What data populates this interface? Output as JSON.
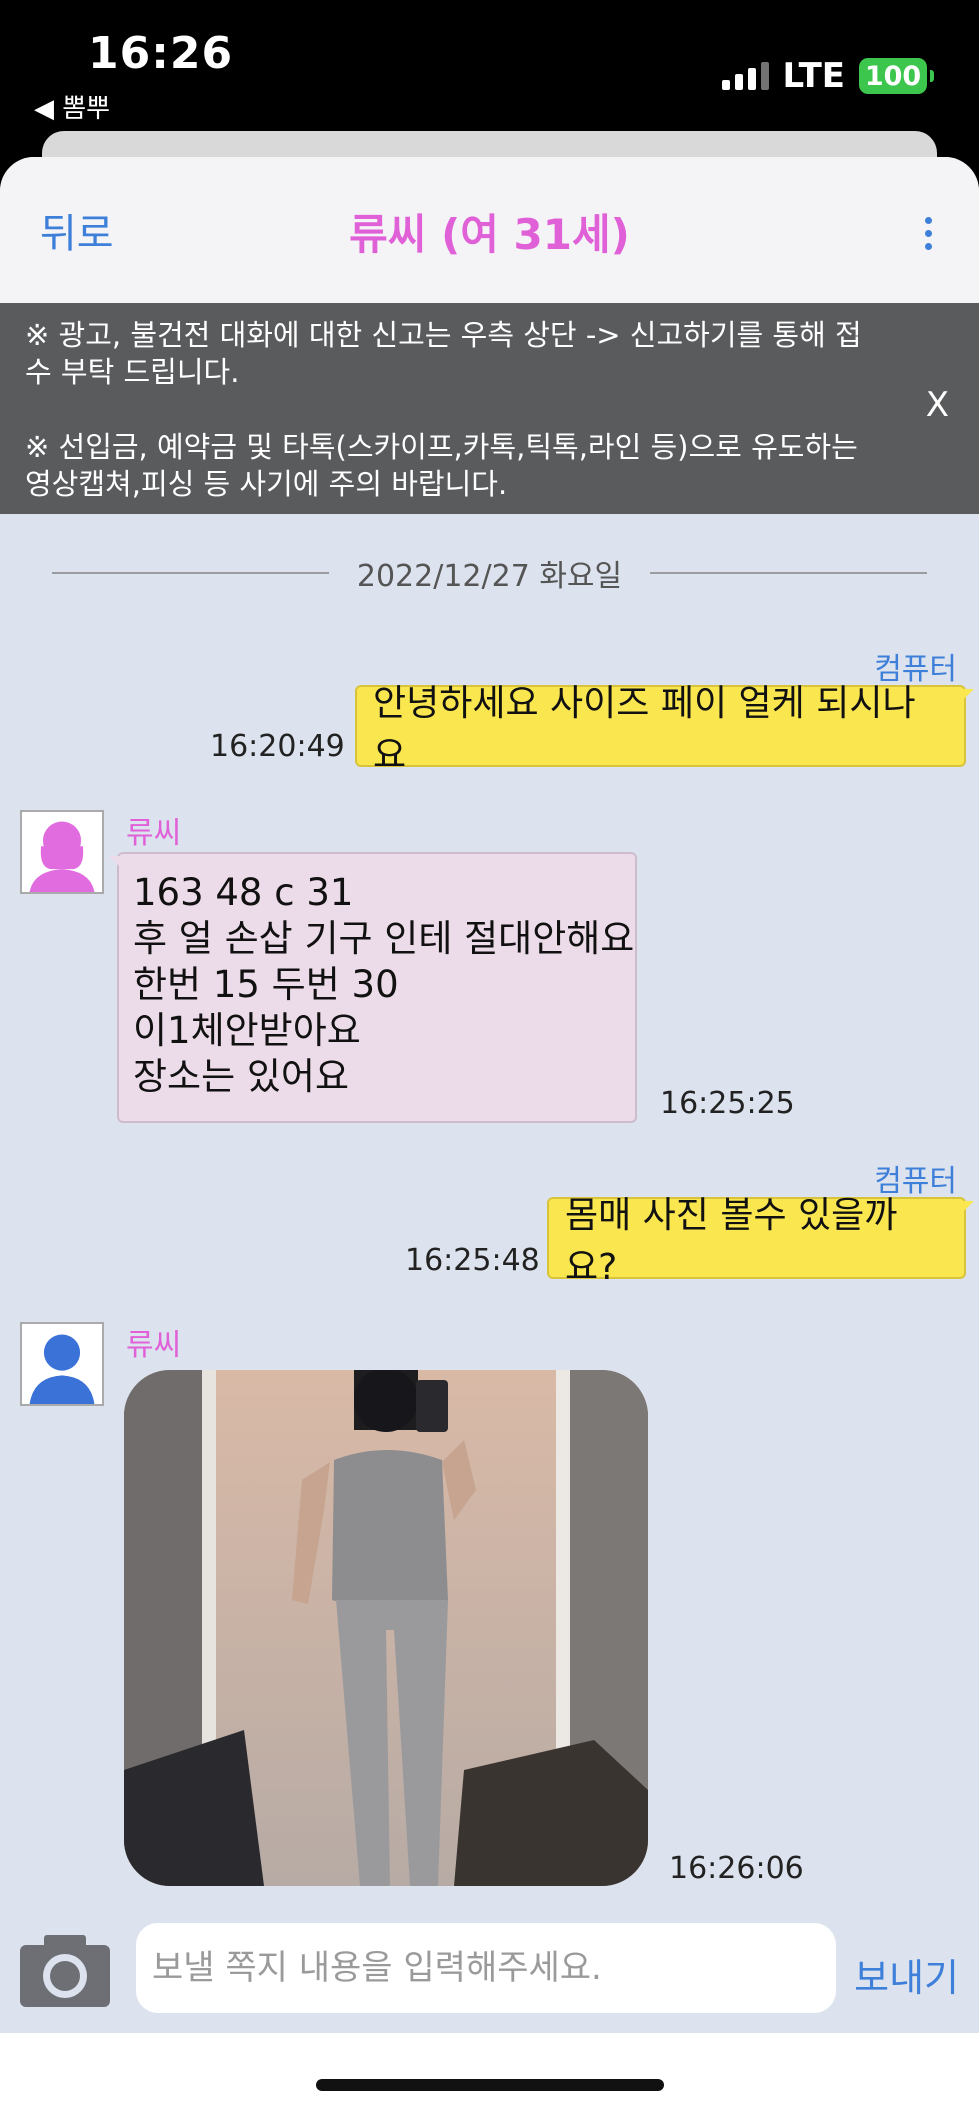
{
  "status_bar": {
    "time": "16:26",
    "back_app": "◀ 뽐뿌",
    "network": "LTE",
    "battery": "100"
  },
  "header": {
    "back_label": "뒤로",
    "title": "류씨 (여 31세)",
    "menu_icon": "more-vertical-icon"
  },
  "notice": {
    "line1": "※ 광고, 불건전 대화에 대한 신고는 우측 상단 -> 신고하기를 통해 접수 부탁 드립니다.",
    "line2": "※ 선입금, 예약금 및 타톡(스카이프,카톡,틱톡,라인 등)으로 유도하는 영상캡쳐,피싱 등 사기에 주의 바랍니다.",
    "close_label": "X"
  },
  "date_divider": "2022/12/27 화요일",
  "messages": [
    {
      "sender": "컴퓨터",
      "direction": "out",
      "text": "안녕하세요 사이즈 페이 얼케 되시나요",
      "time": "16:20:49"
    },
    {
      "sender": "류씨",
      "direction": "in",
      "lines": [
        "163 48 c 31",
        "후 얼 손삽 기구 인테 절대안해요",
        "한번 15 두번 30",
        "이1체안받아요",
        "장소는 있어요"
      ],
      "time": "16:25:25"
    },
    {
      "sender": "컴퓨터",
      "direction": "out",
      "text": "몸매 사진 볼수 있을까요?",
      "time": "16:25:48"
    },
    {
      "sender": "류씨",
      "direction": "in",
      "type": "image",
      "time": "16:26:06"
    }
  ],
  "compose": {
    "camera_icon": "camera-icon",
    "placeholder": "보낼 쪽지 내용을 입력해주세요.",
    "send_label": "보내기"
  },
  "colors": {
    "accent_blue": "#3d7fd9",
    "name_pink": "#e060d8",
    "outgoing_bubble": "#fae64f",
    "incoming_bubble": "#ecdbe8",
    "chat_background": "#dde3ee",
    "notice_background": "#5a5b5d",
    "battery_green": "#3cc64d"
  }
}
